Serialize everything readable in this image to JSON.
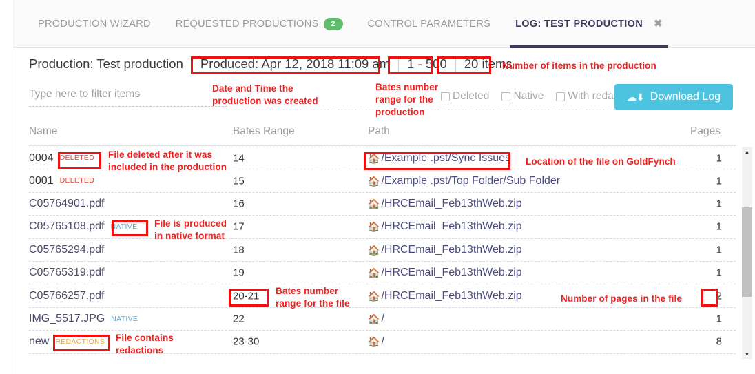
{
  "tabs": [
    {
      "label": "PRODUCTION WIZARD",
      "active": false,
      "badge": ""
    },
    {
      "label": "REQUESTED PRODUCTIONS",
      "active": false,
      "badge": "2"
    },
    {
      "label": "CONTROL PARAMETERS",
      "active": false,
      "badge": ""
    },
    {
      "label": "LOG: TEST PRODUCTION",
      "active": true,
      "badge": "",
      "close": "✖"
    }
  ],
  "header": {
    "production": "Production: Test production",
    "produced": "Produced: Apr 12, 2018 11:09 am",
    "bates_range": "1 - 500",
    "item_count": "20 items"
  },
  "filter": {
    "placeholder": "Type here to filter items",
    "value": ""
  },
  "checkboxes": [
    {
      "label": "Deleted",
      "checked": false
    },
    {
      "label": "Native",
      "checked": false
    },
    {
      "label": "With redactions",
      "checked": false
    }
  ],
  "download_button": {
    "label": "Download Log",
    "icon": "cloud-download-icon",
    "color": "#4ec3e0"
  },
  "table": {
    "columns": [
      "Name",
      "Bates Range",
      "Path",
      "Pages"
    ],
    "home_icon": "🏠",
    "rows": [
      {
        "name": "0004",
        "badge": "DELETED",
        "badge_type": "deleted",
        "bates": "14",
        "path": "/Example .pst/Sync Issues",
        "pages": "1"
      },
      {
        "name": "0001",
        "badge": "DELETED",
        "badge_type": "deleted",
        "bates": "15",
        "path": "/Example .pst/Top Folder/Sub Folder",
        "pages": "1"
      },
      {
        "name": "C05764901.pdf",
        "badge": "",
        "badge_type": "",
        "bates": "16",
        "path": "/HRCEmail_Feb13thWeb.zip",
        "pages": "1"
      },
      {
        "name": "C05765108.pdf",
        "badge": "NATIVE",
        "badge_type": "native",
        "bates": "17",
        "path": "/HRCEmail_Feb13thWeb.zip",
        "pages": "1"
      },
      {
        "name": "C05765294.pdf",
        "badge": "",
        "badge_type": "",
        "bates": "18",
        "path": "/HRCEmail_Feb13thWeb.zip",
        "pages": "1"
      },
      {
        "name": "C05765319.pdf",
        "badge": "",
        "badge_type": "",
        "bates": "19",
        "path": "/HRCEmail_Feb13thWeb.zip",
        "pages": "1"
      },
      {
        "name": "C05766257.pdf",
        "badge": "",
        "badge_type": "",
        "bates": "20-21",
        "path": "/HRCEmail_Feb13thWeb.zip",
        "pages": "2"
      },
      {
        "name": "IMG_5517.JPG",
        "badge": "NATIVE",
        "badge_type": "native",
        "bates": "22",
        "path": "/",
        "pages": "1"
      },
      {
        "name": "new",
        "badge": "REDACTIONS",
        "badge_type": "redactions",
        "bates": "23-30",
        "path": "/",
        "pages": "8"
      }
    ]
  },
  "annotations": {
    "date_time": "Date and Time the\nproduction was created",
    "bates_production": "Bates number\nrange for the\nproduction",
    "item_count": "Number of items in the production",
    "deleted_file": "File deleted after it was\nincluded in the production",
    "native_file": "File is produced\nin native format",
    "bates_file": "Bates number\nrange for the file",
    "path_location": "Location of the file on GoldFynch",
    "pages_count": "Number of pages in the file",
    "redactions_file": "File contains\nredactions"
  },
  "colors": {
    "annotation": "#ee2222",
    "highlight_border": "#ee1111",
    "accent": "#4ec3e0",
    "active_tab": "#3b3a5c",
    "badge_green": "#60bd6d"
  }
}
